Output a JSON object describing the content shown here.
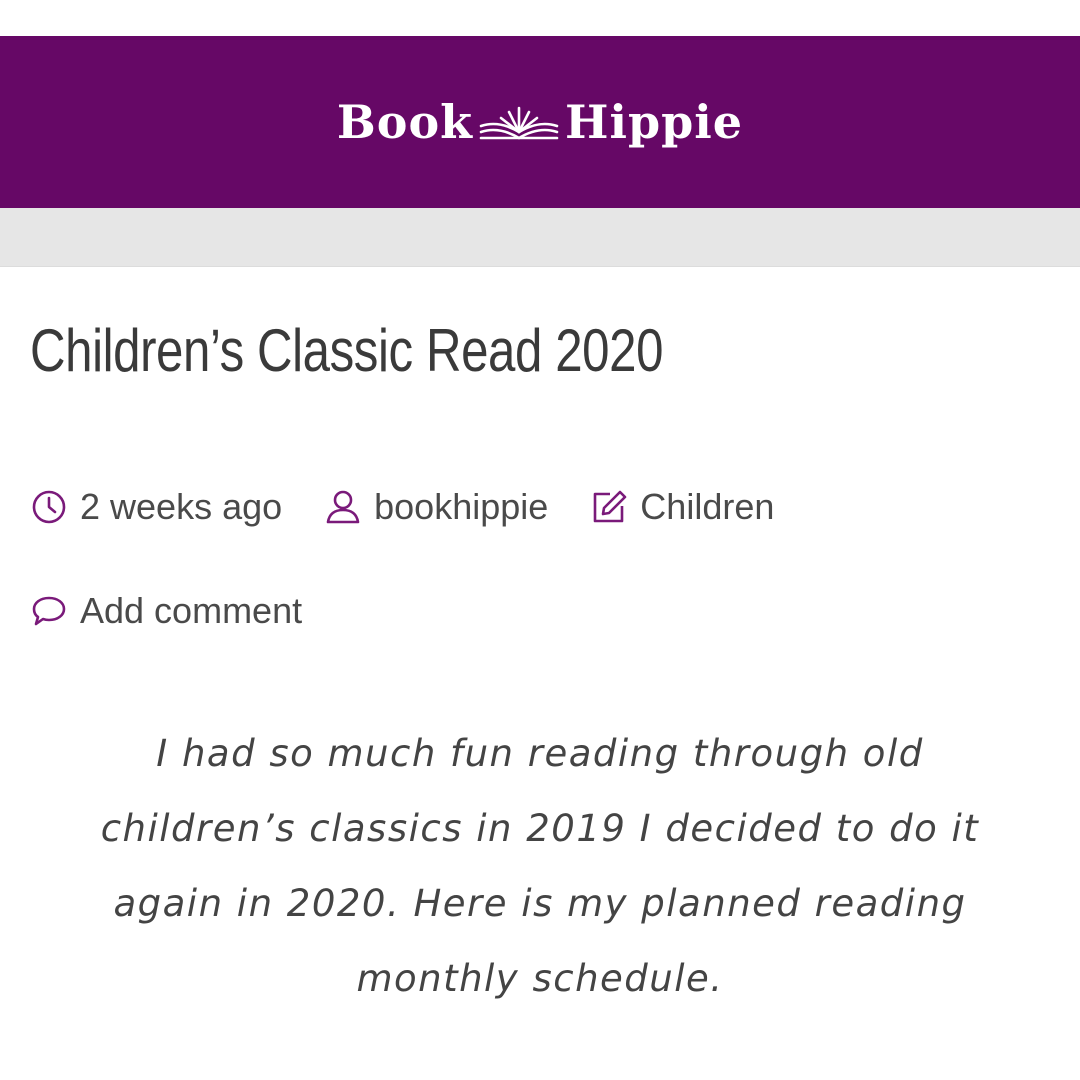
{
  "site": {
    "logo_left": "Book",
    "logo_right": "Hippie",
    "brand_color": "#660866"
  },
  "post": {
    "title": "Children’s Classic Read 2020",
    "meta": {
      "time": "2 weeks ago",
      "author": "bookhippie",
      "category": "Children",
      "comment_link": "Add comment"
    },
    "intro_lines": [
      "I had so much fun reading through old",
      "children’s classics in 2019 I decided to do it",
      "again in 2020. Here is my planned reading",
      "monthly schedule."
    ]
  },
  "icons": {
    "logo": "open-book-icon",
    "time": "clock-icon",
    "author": "user-icon",
    "category": "edit-icon",
    "comment": "comment-icon"
  },
  "colors": {
    "icon_purple": "#7a1a7a",
    "text": "#3a3a3a",
    "subbar": "#e6e6e6"
  }
}
